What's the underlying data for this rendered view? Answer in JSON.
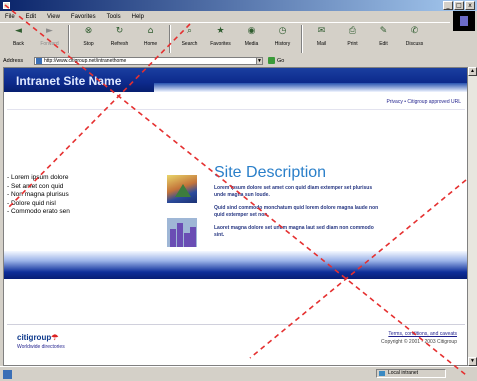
{
  "window": {
    "minimize": "_",
    "maximize": "□",
    "close": "x"
  },
  "menu": [
    "File",
    "Edit",
    "View",
    "Favorites",
    "Tools",
    "Help"
  ],
  "toolbar": [
    {
      "label": "Back",
      "icon": "back-arrow-icon",
      "glyph": "◄",
      "dim": false
    },
    {
      "label": "Forward",
      "icon": "forward-arrow-icon",
      "glyph": "►",
      "dim": true
    },
    {
      "label": "Stop",
      "icon": "stop-icon",
      "glyph": "⊗",
      "dim": false
    },
    {
      "label": "Refresh",
      "icon": "refresh-icon",
      "glyph": "↻",
      "dim": false
    },
    {
      "label": "Home",
      "icon": "home-icon",
      "glyph": "⌂",
      "dim": false
    },
    {
      "label": "Search",
      "icon": "search-icon",
      "glyph": "⌕",
      "dim": false
    },
    {
      "label": "Favorites",
      "icon": "favorites-icon",
      "glyph": "★",
      "dim": false
    },
    {
      "label": "Media",
      "icon": "media-icon",
      "glyph": "◉",
      "dim": false
    },
    {
      "label": "History",
      "icon": "history-icon",
      "glyph": "◷",
      "dim": false
    },
    {
      "label": "Mail",
      "icon": "mail-icon",
      "glyph": "✉",
      "dim": false
    },
    {
      "label": "Print",
      "icon": "print-icon",
      "glyph": "⎙",
      "dim": false
    },
    {
      "label": "Edit",
      "icon": "edit-icon",
      "glyph": "✎",
      "dim": false
    },
    {
      "label": "Discuss",
      "icon": "discuss-icon",
      "glyph": "✆",
      "dim": false
    }
  ],
  "address": {
    "label": "Address",
    "value": "http://www.citigroup.net/intranethome",
    "go": "Go"
  },
  "page": {
    "banner_title": "Intranet Site Name",
    "top_links": "Privacy • Citigroup approved URL",
    "left_nav": [
      "Lorem ipsum dolore",
      "Set amet con quid",
      "Non magna plurisus",
      "Dolore quid nisl",
      "Commodo erato sen"
    ],
    "site_title": "Site Description",
    "desc1": "Lorem ipsum dolore set amet con quid diam extemper set plurisus unde magna sun loude.",
    "desc2": "Quid sind commodo monchatum quid lorem dolore magna laude non quid extemper set non.",
    "desc3": "Laoret magna dolore set unum magna laut sed diam non commodo sint.",
    "logo_main": "citigroup",
    "logo_mark": "☂",
    "logo_sub": "Worldwide directories",
    "terms": "Terms, conditions, and caveats",
    "copyright": "Copyright © 2001 - 2003 Citigroup"
  },
  "status": {
    "zone": "Local intranet"
  }
}
